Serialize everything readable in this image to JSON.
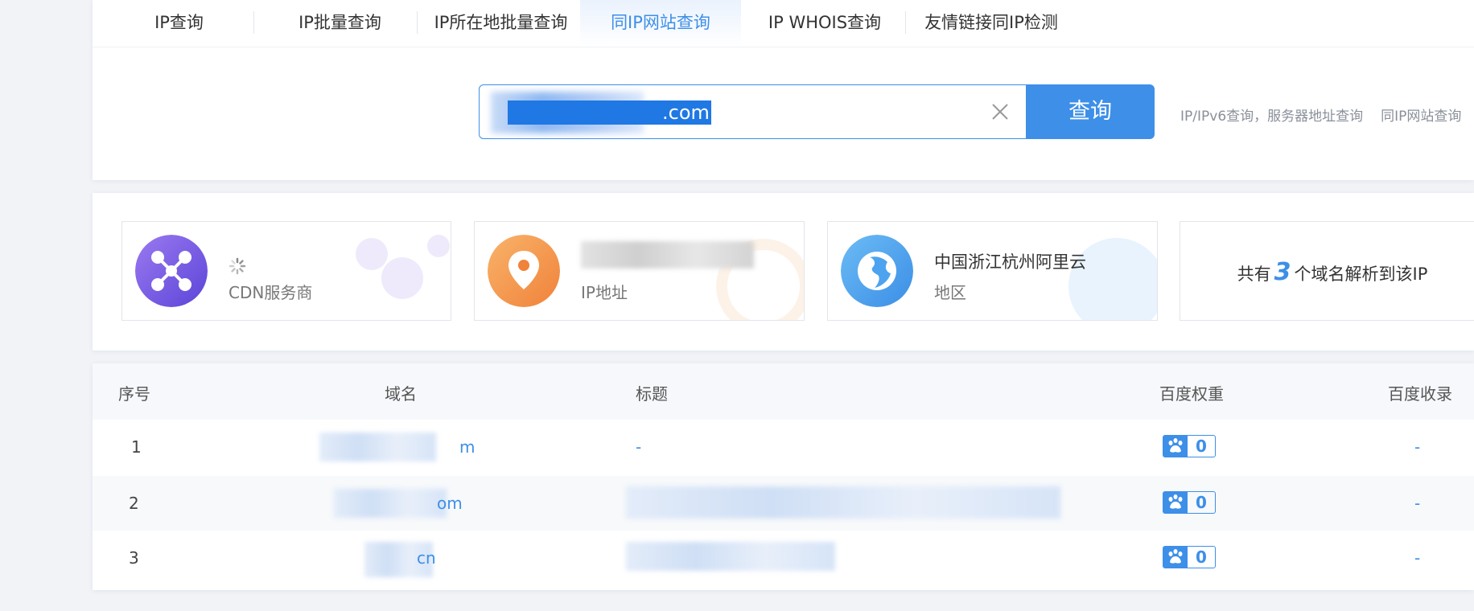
{
  "tabs": [
    {
      "label": "IP查询"
    },
    {
      "label": "IP批量查询"
    },
    {
      "label": "IP所在地批量查询"
    },
    {
      "label": "同IP网站查询"
    },
    {
      "label": "IP WHOIS查询"
    },
    {
      "label": "友情链接同IP检测"
    }
  ],
  "search": {
    "value": ".com",
    "button": "查询"
  },
  "hints": [
    "IP/IPv6查询，服务器地址查询",
    "同IP网站查询"
  ],
  "info": {
    "cdn_label": "CDN服务商",
    "ip_label": "IP地址",
    "region_value": "中国浙江杭州阿里云",
    "region_label": "地区",
    "count_prefix": "共有",
    "count_value": "3",
    "count_suffix": "个域名解析到该IP"
  },
  "table": {
    "headers": {
      "index": "序号",
      "domain": "域名",
      "title": "标题",
      "baidu_weight": "百度权重",
      "baidu_index": "百度收录"
    },
    "rows": [
      {
        "index": "1",
        "domain": "m",
        "title": "-",
        "weight": "0",
        "indexed": "-"
      },
      {
        "index": "2",
        "domain": "om",
        "title": "",
        "weight": "0",
        "indexed": "-"
      },
      {
        "index": "3",
        "domain": "cn",
        "title": "",
        "weight": "0",
        "indexed": "-"
      }
    ]
  },
  "colors": {
    "accent": "#3d8fe8",
    "cdn": "#7b5ee0",
    "ip": "#f59a4a",
    "region": "#4da3ef"
  }
}
